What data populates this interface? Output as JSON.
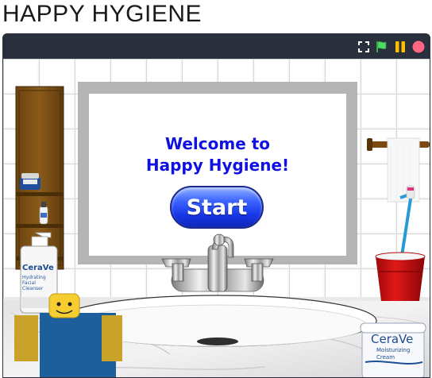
{
  "page": {
    "title": "HAPPY HYGIENE"
  },
  "player": {
    "controls": [
      {
        "name": "fullscreen-icon",
        "color": "#ffffff"
      },
      {
        "name": "green-flag-icon",
        "color": "#4cd964"
      },
      {
        "name": "pause-icon",
        "color": "#ffbf00"
      },
      {
        "name": "stop-icon",
        "color": "#ff6680"
      }
    ]
  },
  "game": {
    "welcome_line1": "Welcome to",
    "welcome_line2": "Happy Hygiene!",
    "start_label": "Start",
    "accent_color": "#1010e0",
    "button_color": "#1737e6"
  },
  "products": {
    "cleanser": {
      "brand": "CeraVe",
      "line1": "Hydrating",
      "line2": "Facial",
      "line3": "Cleanser"
    },
    "cream": {
      "brand": "CeraVe",
      "line1": "Moisturizing",
      "line2": "Cream"
    }
  }
}
